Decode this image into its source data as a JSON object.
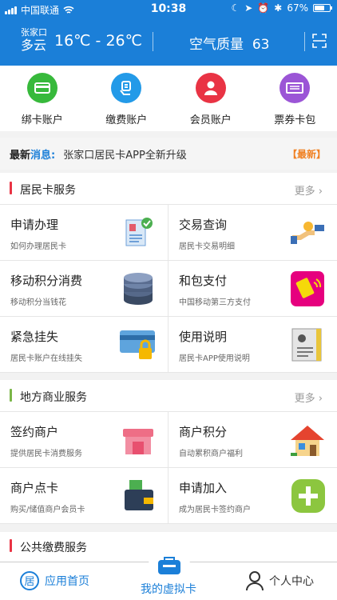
{
  "status": {
    "carrier": "中国联通",
    "time": "10:38",
    "battery": "67%"
  },
  "weather": {
    "city": "张家口",
    "condition": "多云",
    "temp": "16℃ - 26℃",
    "aqi_label": "空气质量",
    "aqi_value": "63"
  },
  "quick": [
    {
      "label": "绑卡账户",
      "color": "#37b93b"
    },
    {
      "label": "缴费账户",
      "color": "#239ae8"
    },
    {
      "label": "会员账户",
      "color": "#e93344"
    },
    {
      "label": "票券卡包",
      "color": "#9b55d6"
    }
  ],
  "news": {
    "tag_a": "最新",
    "tag_b": "消息:",
    "text": "张家口居民卡APP全新升级",
    "badge": "【最新】"
  },
  "sections": [
    {
      "title": "居民卡服务",
      "more": "更多",
      "bar": "#e93344",
      "items": [
        {
          "title": "申请办理",
          "sub": "如何办理居民卡",
          "icon": "apply-icon"
        },
        {
          "title": "交易查询",
          "sub": "居民卡交易明细",
          "icon": "transaction-icon"
        },
        {
          "title": "移动积分消费",
          "sub": "移动积分当钱花",
          "icon": "coins-icon"
        },
        {
          "title": "和包支付",
          "sub": "中国移动第三方支付",
          "icon": "hebao-pay-icon"
        },
        {
          "title": "紧急挂失",
          "sub": "居民卡账户在线挂失",
          "icon": "card-lock-icon"
        },
        {
          "title": "使用说明",
          "sub": "居民卡APP使用说明",
          "icon": "manual-icon"
        }
      ]
    },
    {
      "title": "地方商业服务",
      "more": "更多",
      "bar": "#7ab648",
      "items": [
        {
          "title": "签约商户",
          "sub": "提供居民卡消费服务",
          "icon": "shop-icon"
        },
        {
          "title": "商户积分",
          "sub": "自动累积商户福利",
          "icon": "house-icon"
        },
        {
          "title": "商户点卡",
          "sub": "购买/储值商户会员卡",
          "icon": "wallet-icon"
        },
        {
          "title": "申请加入",
          "sub": "成为居民卡签约商户",
          "icon": "plus-icon"
        }
      ]
    },
    {
      "title": "公共缴费服务",
      "bar": "#e93344"
    }
  ],
  "tabs": {
    "home": "应用首页",
    "card": "我的虚拟卡",
    "me": "个人中心"
  }
}
